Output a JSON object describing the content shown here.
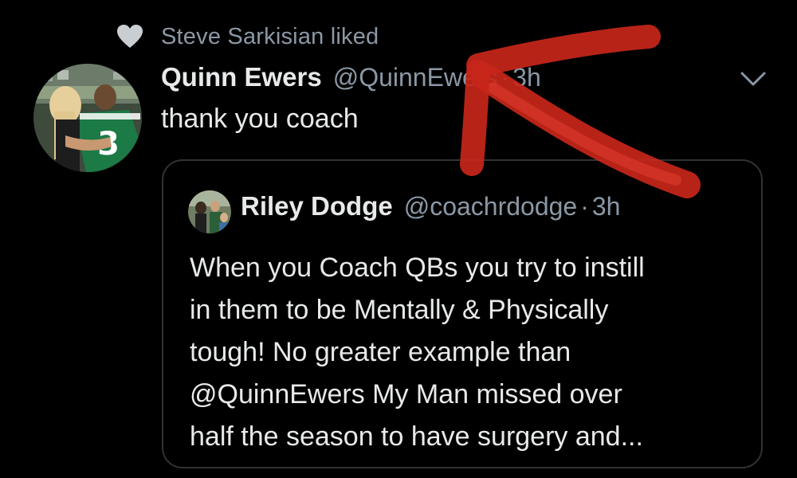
{
  "social_context": {
    "text": "Steve Sarkisian liked",
    "icon": "heart-icon"
  },
  "tweet": {
    "display_name": "Quinn Ewers",
    "handle": "@QuinnEwers",
    "separator": "·",
    "time": "3h",
    "text": "thank you coach",
    "menu_icon": "chevron-down-icon",
    "avatar_jersey_number": "3"
  },
  "quoted_tweet": {
    "display_name": "Riley Dodge",
    "handle": "@coachrdodge",
    "separator": "·",
    "time": "3h",
    "lines": [
      "When you Coach QBs you try to instill",
      "in them to be Mentally & Physically",
      "tough! No greater example than",
      "@QuinnEwers My Man missed over",
      "half the season to have surgery and..."
    ]
  },
  "colors": {
    "background": "#000000",
    "primary_text": "#e7e9ea",
    "secondary_text": "#8b98a5",
    "border": "#2f3336",
    "annotation_arrow": "#c8261a"
  }
}
